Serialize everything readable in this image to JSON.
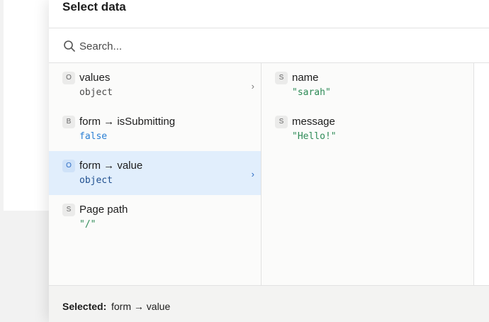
{
  "dialog": {
    "title": "Select data"
  },
  "search": {
    "placeholder": "Search..."
  },
  "left_column": {
    "items": [
      {
        "badge": "O",
        "label": "values",
        "value": "object",
        "has_children": true,
        "selected": false
      },
      {
        "badge": "B",
        "label": "form → isSubmitting",
        "value": "false",
        "has_children": false,
        "selected": false
      },
      {
        "badge": "O",
        "label": "form → value",
        "value": "object",
        "has_children": true,
        "selected": true
      },
      {
        "badge": "S",
        "label": "Page path",
        "value": "\"/\"",
        "has_children": false,
        "selected": false
      }
    ]
  },
  "middle_column": {
    "items": [
      {
        "badge": "S",
        "label": "name",
        "value": "\"sarah\""
      },
      {
        "badge": "S",
        "label": "message",
        "value": "\"Hello!\""
      }
    ]
  },
  "footer": {
    "selected_label": "Selected:",
    "selected_value": "form → value"
  },
  "icons": {
    "search": "search-icon",
    "chevron": "chevron-right-icon"
  },
  "colors": {
    "selected_row_bg": "#e1eefc",
    "string_value": "#2e8b57",
    "boolean_value": "#2a7fd4"
  }
}
